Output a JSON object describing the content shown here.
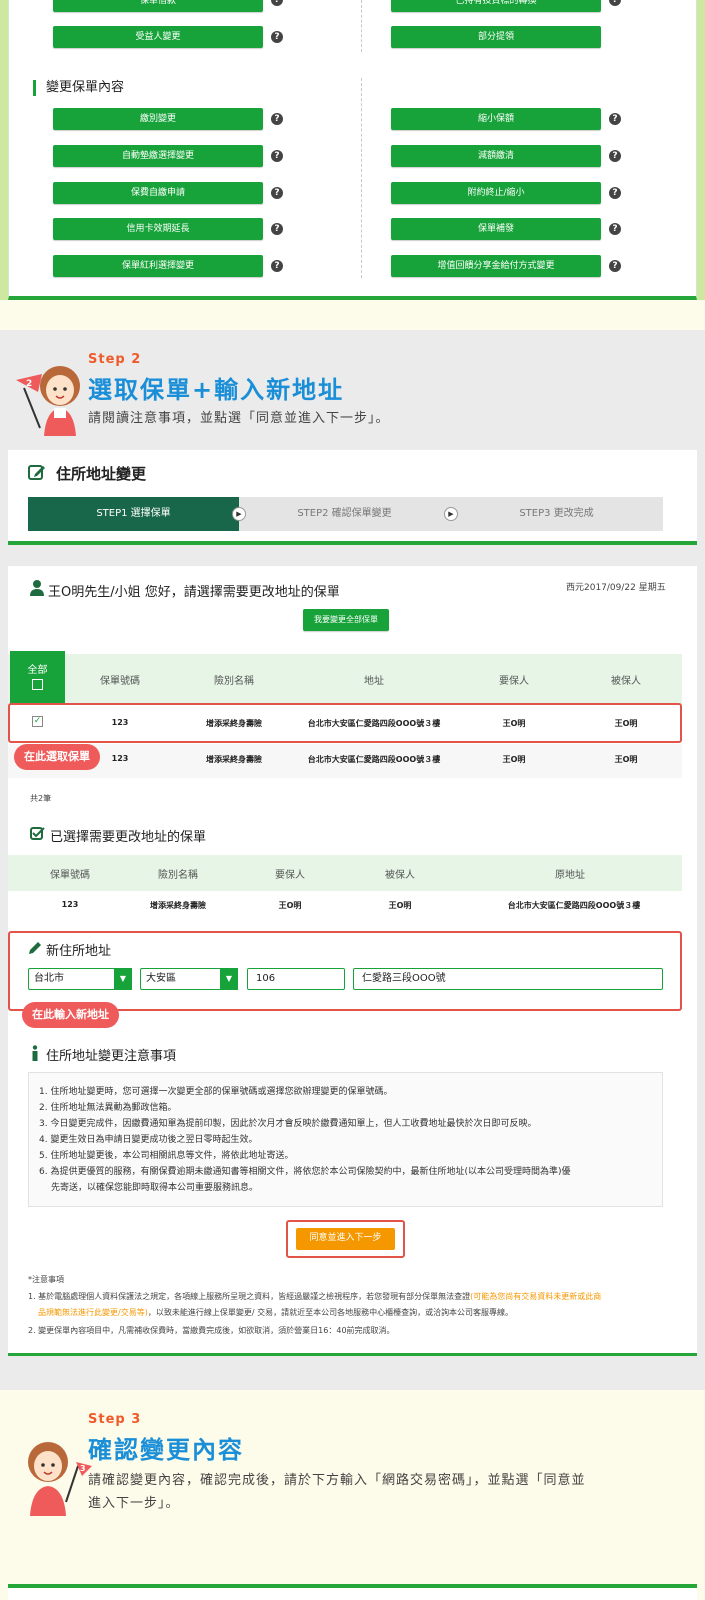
{
  "sec1": {
    "top_left_partial": "保單借款",
    "top_right_partial": "已持有投資標的轉換",
    "row_a": {
      "left": "受益人變更",
      "right": "部分提領"
    },
    "category_title": "變更保單內容",
    "left_buttons": [
      "繳別變更",
      "自動墊繳選擇變更",
      "保費自繳申請",
      "信用卡效期延長",
      "保單紅利選擇變更"
    ],
    "right_buttons": [
      "縮小保額",
      "減額繳清",
      "附約終止/縮小",
      "保單補發",
      "增值回饋分享金給付方式變更"
    ],
    "help_glyph": "?"
  },
  "step2": {
    "label": "Step 2",
    "title": "選取保單+輸入新地址",
    "desc": "請閱讀注意事項，並點選「同意並進入下一步」。"
  },
  "panel1": {
    "title": "住所地址變更",
    "steps": [
      "STEP1 選擇保單",
      "STEP2 確認保單變更",
      "STEP3 更改完成"
    ]
  },
  "panel2": {
    "greeting": "王O明先生/小姐 您好，請選擇需要更改地址的保單",
    "date": "西元2017/09/22 星期五",
    "change_all_btn": "我要變更全部保單",
    "select_all": "全部",
    "headers": [
      "保單號碼",
      "險別名稱",
      "地址",
      "要保人",
      "被保人"
    ],
    "rows": [
      {
        "no": "123",
        "name": "增添采終身壽險",
        "addr": "台北市大安區仁愛路四段OOO號３樓",
        "holder": "王O明",
        "insured": "王O明"
      },
      {
        "no": "123",
        "name": "增添采終身壽險",
        "addr": "台北市大安區仁愛路四段OOO號３樓",
        "holder": "王O明",
        "insured": "王O明"
      }
    ],
    "pick_tip": "在此選取保單",
    "count": "共2筆",
    "selected_title": "已選擇需要更改地址的保單",
    "sel_headers": [
      "保單號碼",
      "險別名稱",
      "要保人",
      "被保人",
      "原地址"
    ],
    "sel_row": {
      "no": "123",
      "name": "增添采終身壽險",
      "holder": "王O明",
      "insured": "王O明",
      "addr": "台北市大安區仁愛路四段OOO號３樓"
    },
    "new_addr_title": "新住所地址",
    "city": "台北市",
    "district": "大安區",
    "zip": "106",
    "street": "仁愛路三段OOO號",
    "addr_tip": "在此輸入新地址",
    "notice_title": "住所地址變更注意事項",
    "notices": [
      "1. 住所地址變更時，您可選擇一次變更全部的保單號碼或選擇您欲辦理變更的保單號碼。",
      "2. 住所地址無法異動為郵政信箱。",
      "3. 今日變更完成件，因繳費通知單為提前印製，因此於次月才會反映於繳費通知單上，但人工收費地址最快於次日即可反映。",
      "4. 變更生效日為申請日變更成功後之翌日零時起生效。",
      "5. 住所地址變更後，本公司相關訊息等文件，將依此地址寄送。",
      "6. 為提供更優質的服務，有關保費逾期未繳通知書等相關文件，將依您於本公司保險契約中，最新住所地址(以本公司受理時間為準)優",
      "先寄送，以確保您能即時取得本公司重要服務訊息。"
    ],
    "agree_btn": "同意並進入下一步",
    "foot_title": "*注意事項",
    "foot1_a": "1. 基於電腦處理個人資料保護法之規定，各項線上服務所呈現之資料，皆經過嚴謹之檢視程序，若您發現有部分保單無法查證",
    "foot1_orange": "(可能為您尚有交易資料未更新或此商",
    "foot1_orange2": "品規範無法進行此變更/交易等)",
    "foot1_b": "，以致未能進行線上保單變更/ 交易，請就近至本公司各地服務中心櫃檯查詢，或洽詢本公司客服專線。",
    "foot2": "2. 變更保單內容項目中，凡需補收保費時，當繳費完成後，如欲取消，須於營業日16：40前完成取消。"
  },
  "step3": {
    "label": "Step 3",
    "title": "確認變更內容",
    "desc1": "請確認變更內容，確認完成後，請於下方輸入「網路交易密碼」，並點選「同意並",
    "desc2": "進入下一步」。"
  },
  "colors": {
    "green": "#17a33a",
    "dark_green": "#18674a",
    "orange": "#f59800",
    "red": "#e2534a",
    "blue": "#1a8fd8"
  }
}
